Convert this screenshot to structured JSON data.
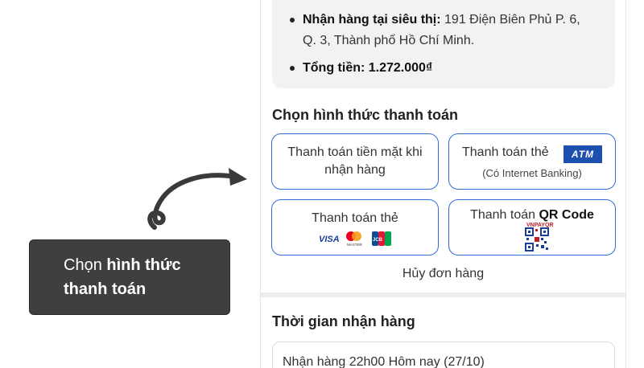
{
  "summary": {
    "pickup_label": "Nhận hàng tại siêu thị:",
    "pickup_address_line1": "191 Điện Biên Phủ P. 6,",
    "pickup_address_line2": "Q. 3, Thành phố Hồ Chí Minh.",
    "total_label": "Tổng tiền:",
    "total_value": "1.272.000₫"
  },
  "payment": {
    "title": "Chọn hình thức thanh toán",
    "options": [
      {
        "label": "Thanh toán tiền mặt khi nhận hàng"
      },
      {
        "label": "Thanh toán thẻ",
        "badge": "ATM",
        "sub": "(Có Internet Banking)"
      },
      {
        "label": "Thanh toán thẻ",
        "card_logos": [
          "VISA",
          "MASTER",
          "JCB"
        ]
      },
      {
        "label_prefix": "Thanh toán",
        "label_bold": "QR Code",
        "brand": "VNPAYQR"
      }
    ],
    "cancel_label": "Hủy đơn hàng"
  },
  "delivery": {
    "title": "Thời gian nhận hàng",
    "selected": "Nhận hàng 22h00 Hôm nay (27/10)"
  },
  "callout": {
    "prefix": "Chọn",
    "bold_line1": "hình thức",
    "bold_line2": "thanh toán"
  },
  "colors": {
    "accent_border": "#2f6bd8",
    "atm_badge": "#1d4fae",
    "callout_bg": "#3f3f3f",
    "summary_bg": "#f2f2f2"
  }
}
